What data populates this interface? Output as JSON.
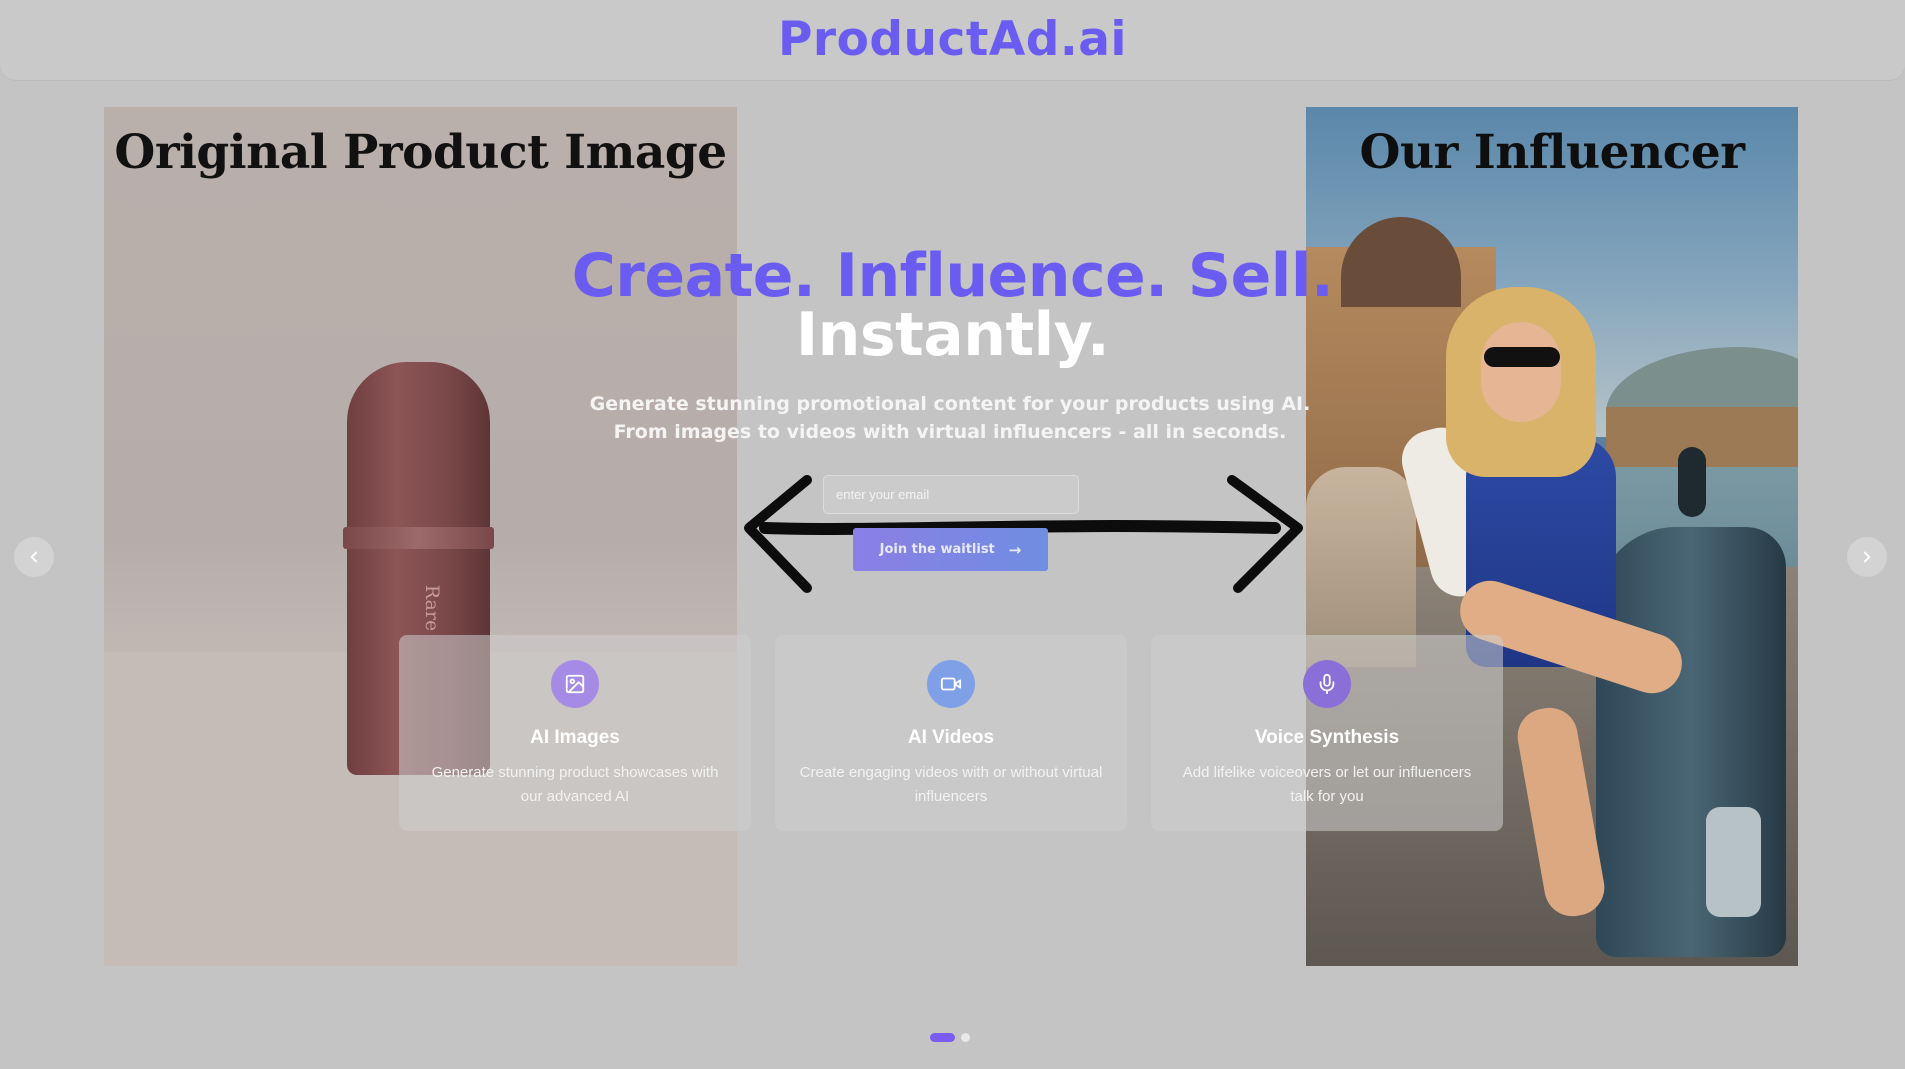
{
  "header": {
    "brand": "ProductAd.ai"
  },
  "slide": {
    "left_title": "Original Product Image",
    "right_title": "Our Influencer",
    "product_text": "Rare"
  },
  "hero": {
    "line1": "Create. Influence. Sell.",
    "line2": "Instantly.",
    "subtitle": "Generate stunning promotional content for your products using AI. From images to videos with virtual influencers - all in seconds."
  },
  "waitlist": {
    "email_placeholder": "enter your email",
    "email_value": "",
    "button_label": "Join the waitlist",
    "button_icon": "arrow-right-icon"
  },
  "features": [
    {
      "title": "AI Images",
      "description": "Generate stunning product showcases with our advanced AI",
      "icon": "image-icon"
    },
    {
      "title": "AI Videos",
      "description": "Create engaging videos with or without virtual influencers",
      "icon": "video-icon"
    },
    {
      "title": "Voice Synthesis",
      "description": "Add lifelike voiceovers or let our influencers talk for you",
      "icon": "microphone-icon"
    }
  ],
  "carousel": {
    "prev_icon": "chevron-left-icon",
    "next_icon": "chevron-right-icon",
    "slide_count": 2,
    "active_index": 0
  },
  "colors": {
    "brand": "#6a5cf0",
    "background": "#c4c4c4",
    "cta_start": "#8b7fe5",
    "cta_end": "#6f8ee2",
    "active_dot": "#7b5cf0"
  }
}
